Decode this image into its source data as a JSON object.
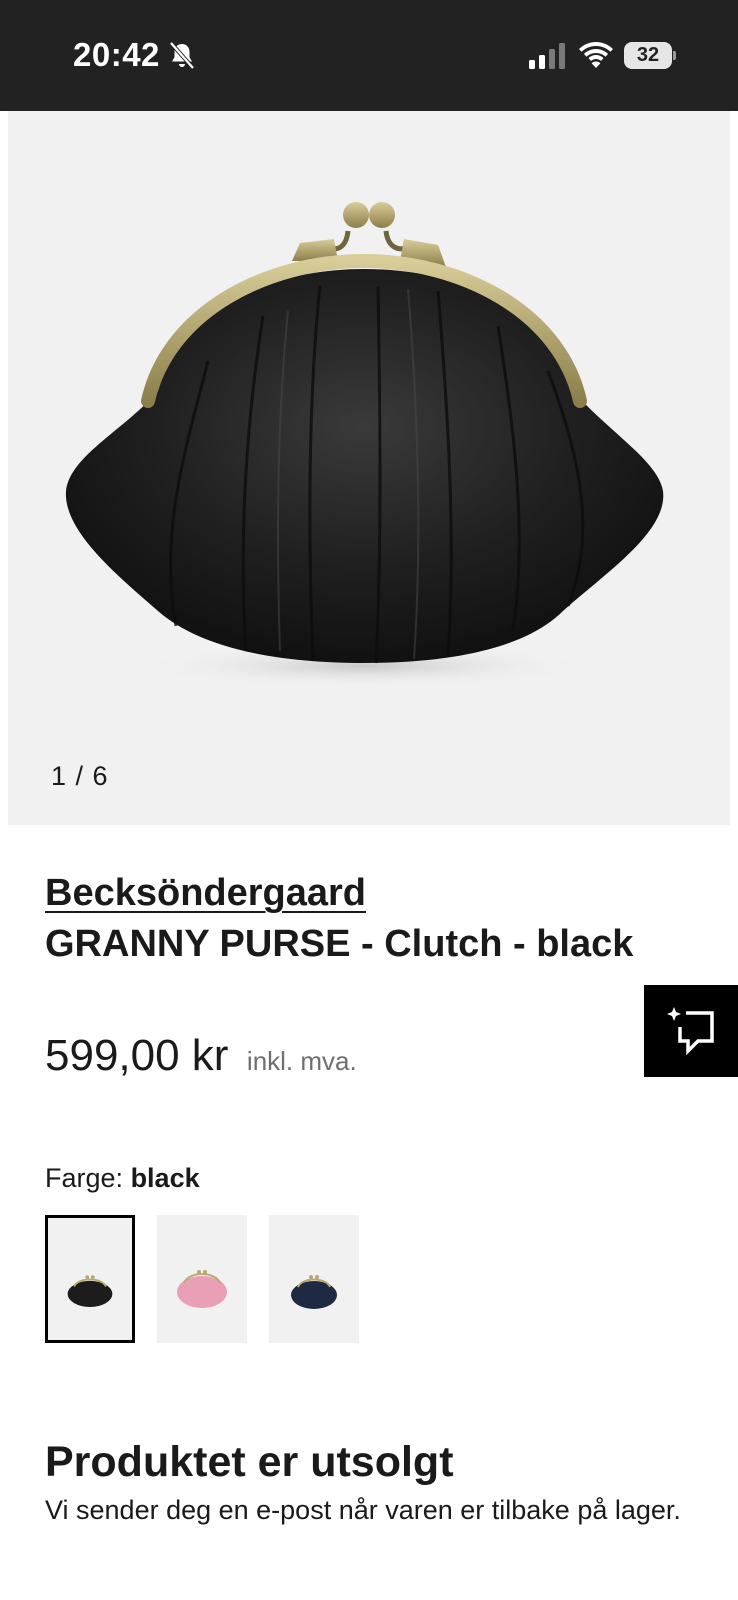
{
  "status_bar": {
    "time": "20:42",
    "battery": "32"
  },
  "gallery": {
    "counter": "1 / 6"
  },
  "product": {
    "brand": "Becksöndergaard",
    "title": "GRANNY PURSE - Clutch - black",
    "price": "599,00 kr",
    "vat_note": "inkl. mva."
  },
  "color_selector": {
    "label": "Farge:",
    "selected": "black",
    "swatches": [
      {
        "color": "black",
        "hex": "#1c1c1c"
      },
      {
        "color": "pink",
        "hex": "#e9a0b6"
      },
      {
        "color": "navy",
        "hex": "#1e2a44"
      }
    ]
  },
  "availability": {
    "title": "Produktet er utsolgt",
    "message": "Vi sender deg en e-post når varen er tilbake på lager."
  },
  "icons": {
    "bell": "bell-muted-icon",
    "signal": "cellular-signal-icon",
    "wifi": "wifi-icon",
    "battery": "battery-icon",
    "compare": "compare-sparkle-icon"
  },
  "colors": {
    "status_bar_bg": "#222222",
    "gallery_bg": "#f1f1f1",
    "accent": "#000000"
  }
}
